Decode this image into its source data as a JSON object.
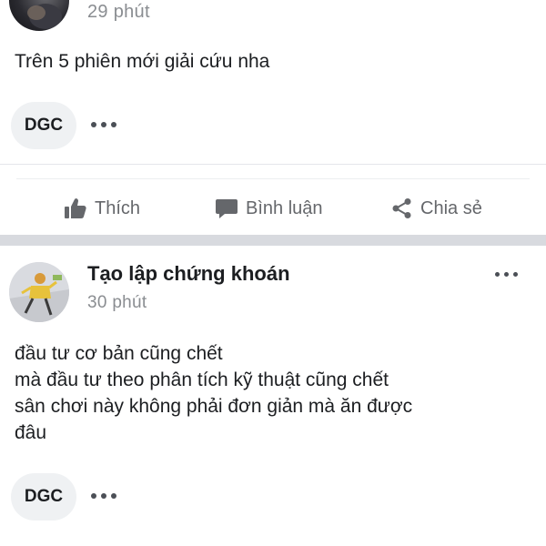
{
  "post1": {
    "time": "29 phút",
    "body": "Trên 5 phiên mới giải cứu nha",
    "tag": "DGC"
  },
  "actions": {
    "like": "Thích",
    "comment": "Bình luận",
    "share": "Chia sẻ"
  },
  "post2": {
    "author": "Tạo lập chứng khoán",
    "time": "30 phút",
    "body_lines": [
      "đầu tư cơ bản cũng chết",
      "mà đầu tư theo phân tích kỹ thuật cũng chết",
      "sân chơi này không phải đơn giản mà ăn được",
      "đâu"
    ],
    "tag": "DGC"
  },
  "colors": {
    "text": "#1c1e21",
    "secondary": "#65676b",
    "timestamp": "#8a8d91",
    "tag_bg": "#eff1f3",
    "separator": "#d8dadf"
  },
  "icons": {
    "like": "thumbs-up-icon",
    "comment": "speech-bubble-icon",
    "share": "share-icon",
    "more": "more-dots-icon"
  }
}
